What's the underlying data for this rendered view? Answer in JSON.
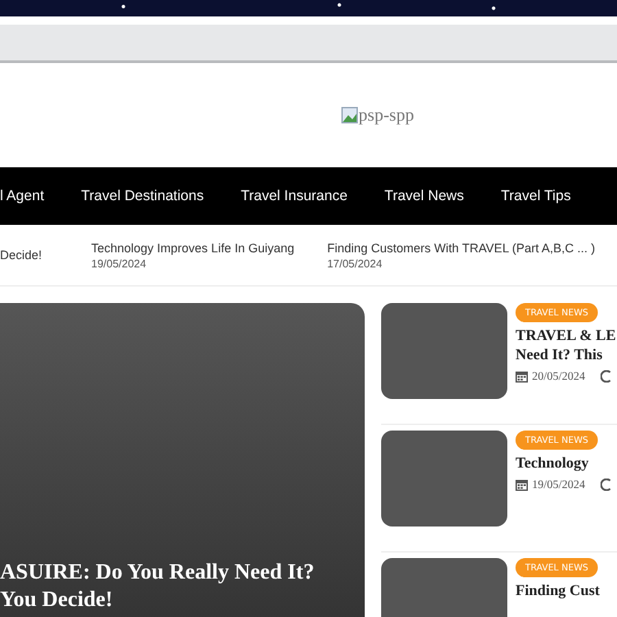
{
  "header": {
    "logo_alt": "psp-spp"
  },
  "nav": {
    "items": [
      {
        "label": "l Agent"
      },
      {
        "label": "Travel Destinations"
      },
      {
        "label": "Travel Insurance"
      },
      {
        "label": "Travel News"
      },
      {
        "label": "Travel Tips"
      }
    ]
  },
  "ticker": [
    {
      "title": "Decide!"
    },
    {
      "title": "Technology Improves Life In Guiyang",
      "date": "19/05/2024"
    },
    {
      "title": "Finding Customers With TRAVEL (Part A,B,C ... )",
      "date": "17/05/2024"
    }
  ],
  "featured": {
    "title_lines": [
      "ASUIRE: Do You Really Need It?",
      "You Decide!"
    ]
  },
  "side_posts": [
    {
      "category": "TRAVEL NEWS",
      "title_lines": [
        "TRAVEL & LE",
        "Need It? This"
      ],
      "date": "20/05/2024"
    },
    {
      "category": "TRAVEL NEWS",
      "title_lines": [
        "Technology"
      ],
      "date": "19/05/2024"
    },
    {
      "category": "TRAVEL NEWS",
      "title_lines": [
        "Finding Cust"
      ]
    }
  ]
}
